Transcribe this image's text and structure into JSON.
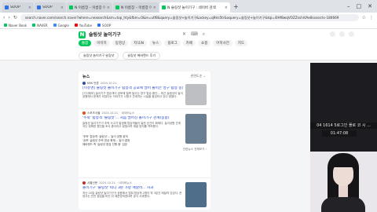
{
  "browser": {
    "tabs": [
      {
        "label": "SOOP",
        "color": "#2f6fe4",
        "active": false
      },
      {
        "label": "SOOP",
        "color": "#2f6fe4",
        "active": false
      },
      {
        "label": "N 이름장 – 이름장 이…",
        "color": "#03c75a",
        "active": false
      },
      {
        "label": "N 이름장 – 이름장 이…",
        "color": "#03c75a",
        "active": false
      },
      {
        "label": "N 슬링샷 놀이기구 : 네이버 검색",
        "color": "#03c75a",
        "active": true
      }
    ],
    "new_tab_label": "+",
    "url": "search.naver.com/search.naver?where=nexearch&sm=top_hty&fbm=0&ie=utf8&query=슬링샷+놀이기구&ackey=q9kn5tr&oquery=슬링샷+놀이기구&tqi=i0Hf8wqVOZZsshiVAe8sssssrlo-180669",
    "bookmarks": [
      {
        "label": "Naver Book",
        "color": "#03c75a"
      },
      {
        "label": "NAVER",
        "color": "#03c75a"
      },
      {
        "label": "Google",
        "color": "#4285f4"
      },
      {
        "label": "YouTube",
        "color": "#ff0000"
      },
      {
        "label": "SOOP",
        "color": "#2f6fe4"
      }
    ]
  },
  "search": {
    "logo": "N",
    "query": "슬링샷 놀이기구",
    "tabs": [
      "통합",
      "이미지",
      "동영상",
      "지식iN",
      "뉴스",
      "블로그",
      "카페",
      "쇼핑",
      "어학사전",
      "지도"
    ],
    "active_tab_index": 0,
    "chips": [
      "슬링샷 놀이기구 슬링샷",
      "슬링샷 에버랜드 후기"
    ]
  },
  "news": {
    "title": "뉴스",
    "more": "관련도순 ⌄",
    "items": [
      {
        "press": "KBS 언론",
        "press_color": "#2d4da0",
        "meta": "2024.10.21.",
        "headline": "[이슈앤] 슬링샷 놀이기구 탑승객 공포에 떨어 놀이는 영구 탑승 중단",
        "body": "[기사제보] 놀이기구 탑승객이 공포에 떨며 놀이는 영구 탑승 중단... 최근 슬링샷이 놀이공원에서 문제가 되었다는 이야기가 나왔고 관계자는 시설을 점검하고 있다 밝혔다.",
        "thumb": "#bdbfc3"
      },
      {
        "press": "스포츠서울",
        "press_color": "#e64a19",
        "meta": "2024.10.21. · 네이버뉴스",
        "headline": "'추락' 탑승객 '슬링샷'... 처음 떨어진 놀이기구 관계(종합)",
        "body": "슬링샷 놀이기구가 추락 사고가 발생해 탑승객들이 놀란 순간이 화제다. 놀이공원 관계자는 정확한 원인을 조사 중이라고 밝혔으며 재발 방지를 약속했다.",
        "thumb": "#6b7f93",
        "related": [
          "'추락' 탑승객 '슬링샷'... 놀이 공원 밝혀",
          "'공포' 슬링샷 추락 영상 화제... 놀이 결정",
          "에버랜드 측 '슬링샷 점검 진행 중' 입장"
        ],
        "related_link": "관련뉴스 전체보기 ›"
      },
      {
        "press": "서울신문",
        "press_color": "#c62828",
        "meta": "2024.10.21. · 네이버뉴스",
        "headline": "놀이기구 '슬링샷' 떠다 3분 가량 매달려... 사과",
        "body": "지난 20일 슬링샷 놀이기구가 공중에서 멈춰 탑승객 2명이 약 3분간 매달려 있었다. 운영사는 안전 점검을 마친 뒤 재운영하겠다며 공식 사과했다.",
        "thumb": "#4f6e8a"
      }
    ]
  },
  "stream": {
    "overlay_line1": "04 1614 5로그인 플로 코 시 ...",
    "overlay_line2": "01:47:08"
  }
}
